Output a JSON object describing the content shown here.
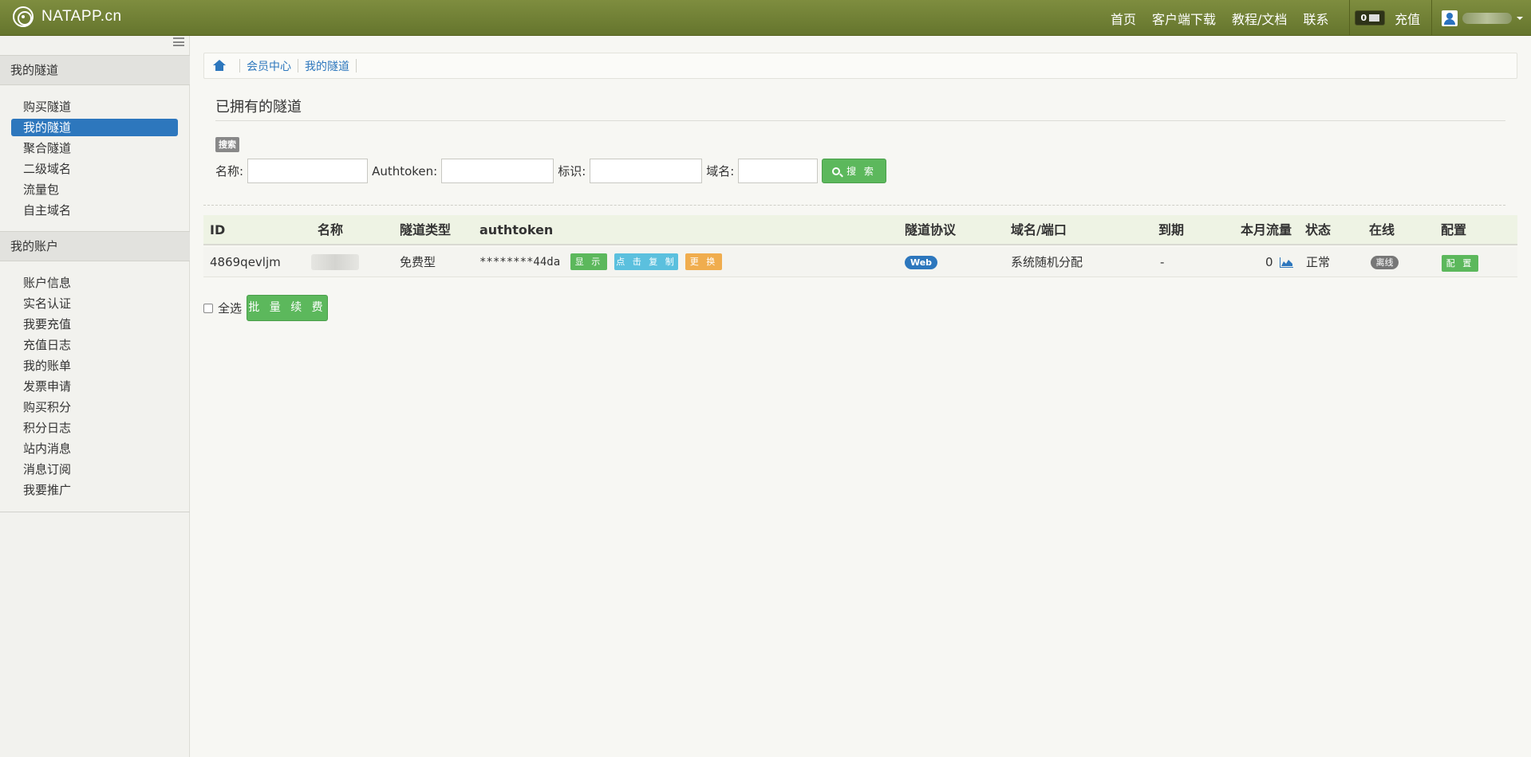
{
  "brand": {
    "name": "NATAPP.cn"
  },
  "nav": {
    "home": "首页",
    "download": "客户端下载",
    "docs": "教程/文档",
    "contact": "联系",
    "message_count": "0",
    "recharge": "充值"
  },
  "sidebar": {
    "section1": "我的隧道",
    "tunnel_items": [
      {
        "label": "购买隧道"
      },
      {
        "label": "我的隧道",
        "active": true
      },
      {
        "label": "聚合隧道"
      },
      {
        "label": "二级域名"
      },
      {
        "label": "流量包"
      },
      {
        "label": "自主域名"
      }
    ],
    "section2": "我的账户",
    "account_items": [
      {
        "label": "账户信息"
      },
      {
        "label": "实名认证"
      },
      {
        "label": "我要充值"
      },
      {
        "label": "充值日志"
      },
      {
        "label": "我的账单"
      },
      {
        "label": "发票申请"
      },
      {
        "label": "购买积分"
      },
      {
        "label": "积分日志"
      },
      {
        "label": "站内消息"
      },
      {
        "label": "消息订阅"
      },
      {
        "label": "我要推广"
      }
    ]
  },
  "breadcrumb": {
    "items": [
      "会员中心",
      "我的隧道"
    ]
  },
  "page": {
    "title": "已拥有的隧道",
    "search_tag": "搜索"
  },
  "search": {
    "name_label": "名称:",
    "name_value": "",
    "authtoken_label": "Authtoken:",
    "authtoken_value": "",
    "tag_label": "标识:",
    "tag_value": "",
    "domain_label": "域名:",
    "domain_value": "",
    "button": "搜 索"
  },
  "table": {
    "headers": {
      "id": "ID",
      "name": "名称",
      "type": "隧道类型",
      "authtoken": "authtoken",
      "protocol": "隧道协议",
      "domain": "域名/端口",
      "expire": "到期",
      "traffic": "本月流量",
      "status": "状态",
      "online": "在线",
      "config": "配置"
    },
    "rows": [
      {
        "id": "4869qevljm",
        "type": "免费型",
        "authtoken": "********44da",
        "btn_show": "显 示",
        "btn_copy": "点 击 复 制",
        "btn_change": "更 换",
        "protocol": "Web",
        "domain": "系统随机分配",
        "expire": "-",
        "traffic": "0",
        "status": "正常",
        "online": "离线",
        "config": "配 置"
      }
    ]
  },
  "actions": {
    "select_all": "全选",
    "batch_renew": "批 量 续 费"
  },
  "colors": {
    "navbar": "#6f7e35",
    "accent_blue": "#2d77bd",
    "button_green": "#5cb85c",
    "button_cyan": "#5bc0de",
    "button_orange": "#f0ad4e"
  }
}
